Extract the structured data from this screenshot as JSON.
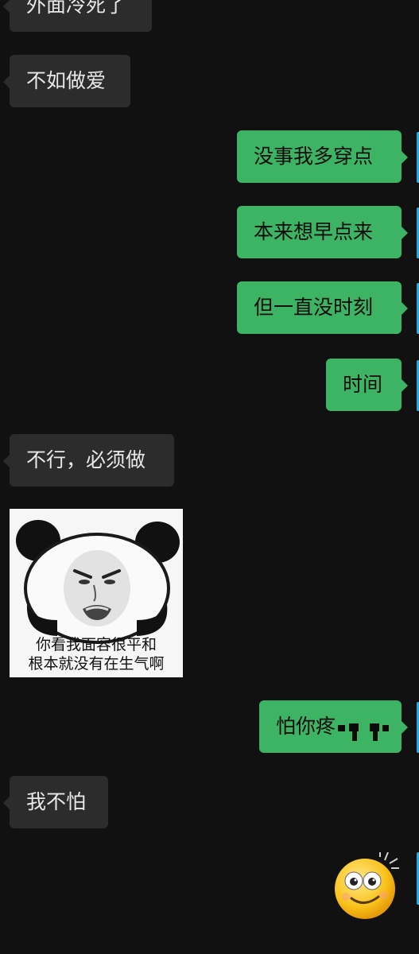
{
  "messages": [
    {
      "side": "in",
      "text": "外面冷死了"
    },
    {
      "side": "in",
      "text": "不如做爱"
    },
    {
      "side": "out",
      "text": "没事我多穿点"
    },
    {
      "side": "out",
      "text": "本来想早点来"
    },
    {
      "side": "out",
      "text": "但一直没时刻"
    },
    {
      "side": "out",
      "text": "时间"
    },
    {
      "side": "in",
      "text": "不行，必须做"
    },
    {
      "side": "in",
      "type": "sticker",
      "caption_line1": "你看我面容很平和",
      "caption_line2": "根本就没有在生气啊"
    },
    {
      "side": "out",
      "text": "怕你疼"
    },
    {
      "side": "in",
      "text": "我不怕"
    },
    {
      "side": "out",
      "type": "emoji",
      "icon": "smiling-face-emoji"
    }
  ],
  "colors": {
    "background": "#111111",
    "incoming_bubble": "#2c2c2c",
    "outgoing_bubble": "#3cb463",
    "avatar_edge": "#2aa9df"
  }
}
